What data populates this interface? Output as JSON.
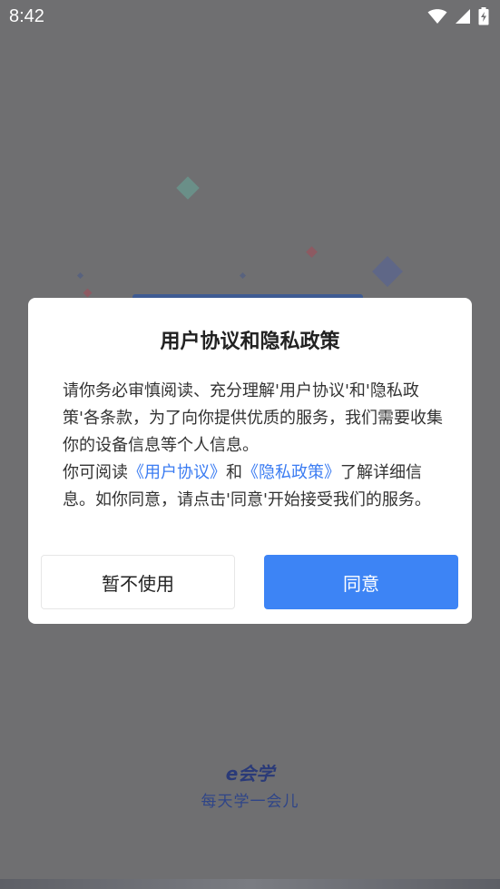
{
  "status_bar": {
    "time": "8:42",
    "icons": [
      "wifi-icon",
      "cellular-signal-icon",
      "battery-charging-icon"
    ]
  },
  "dialog": {
    "title": "用户协议和隐私政策",
    "paragraph1": "请你务必审慎阅读、充分理解'用户协议'和'隐私政策'各条款，为了向你提供优质的服务，我们需要收集你的设备信息等个人信息。",
    "paragraph2": {
      "prefix": "你可阅读",
      "link_user_agreement": "《用户协议》",
      "and": "和",
      "link_privacy_policy": "《隐私政策》",
      "suffix": "了解详细信息。如你同意，请点击'同意'开始接受我们的服务。"
    },
    "decline_label": "暂不使用",
    "agree_label": "同意"
  },
  "brand": {
    "name": "e会学",
    "slogan": "每天学一会儿"
  },
  "colors": {
    "overlay": "#6f6f71",
    "accent": "#3d84f5",
    "link": "#3b7cf2",
    "brand": "#2a3a78"
  }
}
